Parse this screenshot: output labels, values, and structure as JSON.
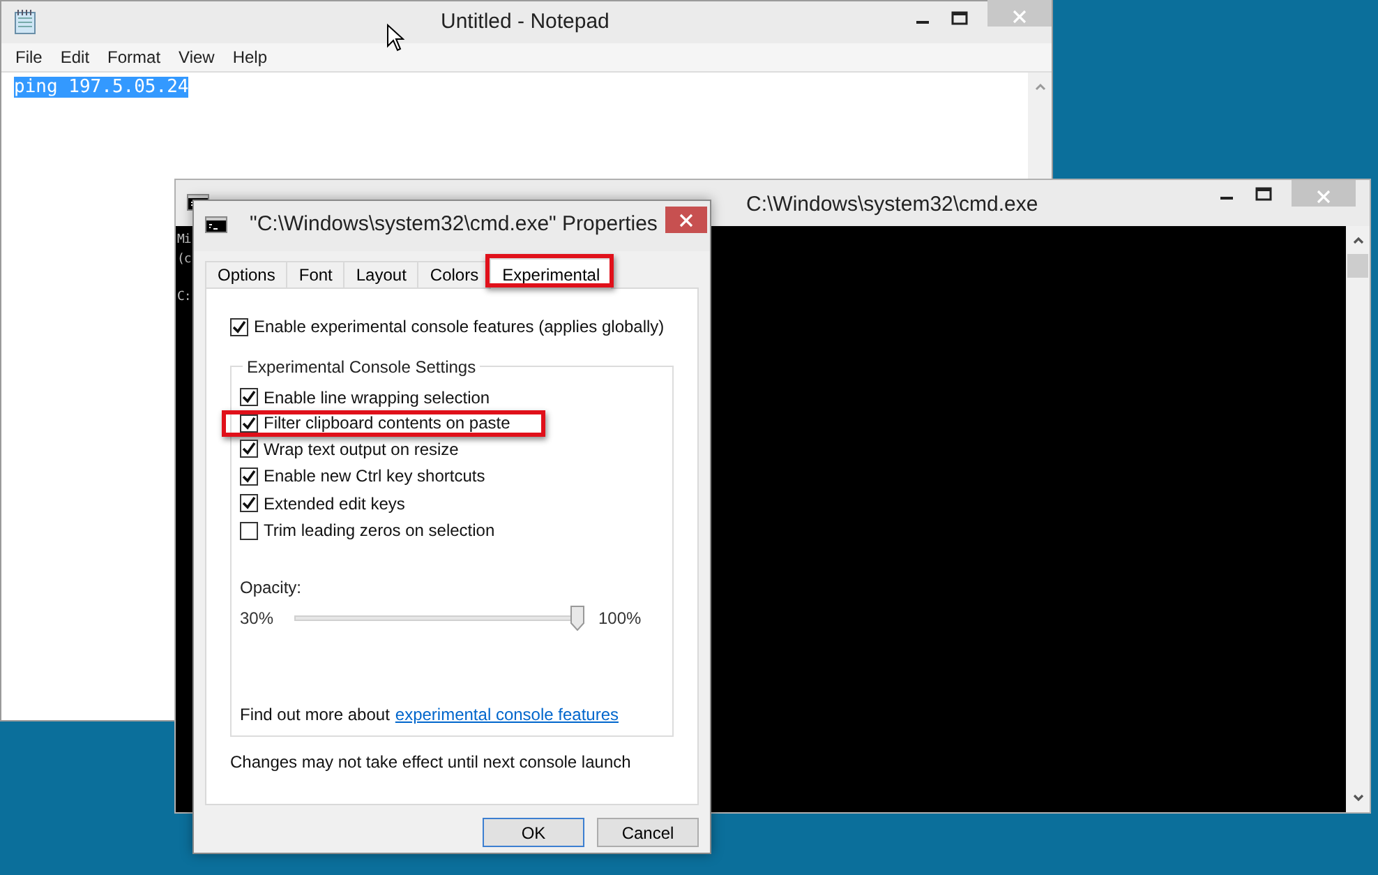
{
  "notepad": {
    "title": "Untitled - Notepad",
    "menu": [
      "File",
      "Edit",
      "Format",
      "View",
      "Help"
    ],
    "text": "ping 197.5.05.24",
    "text_selected": true
  },
  "console": {
    "title": "C:\\Windows\\system32\\cmd.exe",
    "lines": [
      "Mi",
      "(c",
      "C:"
    ]
  },
  "dialog": {
    "title": "\"C:\\Windows\\system32\\cmd.exe\" Properties",
    "tabs": [
      {
        "label": "Options",
        "selected": false,
        "highlighted": false
      },
      {
        "label": "Font",
        "selected": false,
        "highlighted": false
      },
      {
        "label": "Layout",
        "selected": false,
        "highlighted": false
      },
      {
        "label": "Colors",
        "selected": false,
        "highlighted": false
      },
      {
        "label": "Experimental",
        "selected": true,
        "highlighted": true
      }
    ],
    "main_option": {
      "label": "Enable experimental console features (applies globally)",
      "checked": true
    },
    "group": {
      "title": "Experimental Console Settings",
      "options": [
        {
          "label": "Enable line wrapping selection",
          "checked": true,
          "highlighted": false
        },
        {
          "label": "Filter clipboard contents on paste",
          "checked": true,
          "highlighted": true
        },
        {
          "label": "Wrap text output on resize",
          "checked": true,
          "highlighted": false
        },
        {
          "label": "Enable new Ctrl key shortcuts",
          "checked": true,
          "highlighted": false
        },
        {
          "label": "Extended edit keys",
          "checked": true,
          "highlighted": false
        },
        {
          "label": "Trim leading zeros on selection",
          "checked": false,
          "highlighted": false
        }
      ]
    },
    "opacity": {
      "label": "Opacity:",
      "min_label": "30%",
      "max_label": "100%",
      "level": 1.0
    },
    "footer_text": "Find out more about",
    "link": "experimental console features",
    "note": "Changes may not take effect until next console launch",
    "buttons": [
      {
        "label": "OK",
        "default": true
      },
      {
        "label": "Cancel",
        "default": false
      }
    ]
  }
}
